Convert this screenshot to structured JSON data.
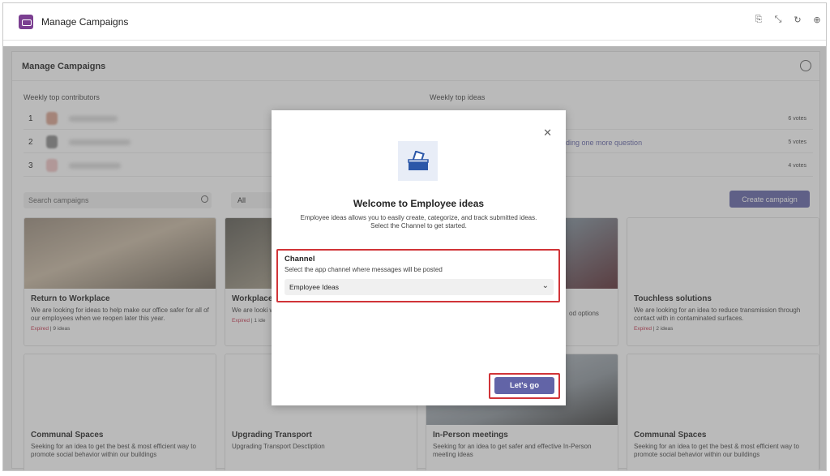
{
  "app": {
    "title": "Manage Campaigns",
    "actions": [
      "chat-icon",
      "minimize-icon",
      "refresh-icon",
      "globe-icon"
    ]
  },
  "page": {
    "heading": "Manage Campaigns",
    "contributors_label": "Weekly top contributors",
    "ideas_label": "Weekly top ideas",
    "contributors": [
      {
        "rank": "1"
      },
      {
        "rank": "2"
      },
      {
        "rank": "3"
      }
    ],
    "ideas": [
      {
        "votes": "6 votes",
        "text": ""
      },
      {
        "votes": "5 votes",
        "text": "dding one more question"
      },
      {
        "votes": "4 votes",
        "text": ""
      }
    ],
    "search_placeholder": "Search campaigns",
    "filter_value": "All",
    "create_label": "Create campaign"
  },
  "cards": [
    {
      "title": "Return to Workplace",
      "desc": "We are looking for ideas to help make our office safer for all of our employees when we reopen later this year.",
      "status": "Expired",
      "ideas": "9 ideas"
    },
    {
      "title": "Workplace",
      "desc": "We are looki workplace",
      "status": "Expired",
      "ideas": "1 ide"
    },
    {
      "title": "",
      "desc": "od options",
      "status": "",
      "ideas": ""
    },
    {
      "title": "Touchless solutions",
      "desc": "We are looking for an idea to reduce transmission through contact with in contaminated surfaces.",
      "status": "Expired",
      "ideas": "2 ideas"
    },
    {
      "title": "Communal Spaces",
      "desc": "Seeking for an idea to get the best & most efficient way to promote social behavior within our buildings"
    },
    {
      "title": "Upgrading Transport",
      "desc": "Upgrading Transport  Desctiption"
    },
    {
      "title": "In-Person meetings",
      "desc": "Seeking for an idea to get safer and effective In-Person meeting ideas"
    },
    {
      "title": "Communal Spaces",
      "desc": "Seeking for an idea to get the best & most efficient way to promote social behavior within our buildings"
    }
  ],
  "dialog": {
    "close": "✕",
    "title": "Welcome to Employee ideas",
    "description": "Employee ideas allows you to easily create, categorize, and track submitted ideas. Select the Channel to get started.",
    "channel_label": "Channel",
    "channel_help": "Select the app channel where messages will be posted",
    "channel_value": "Employee Ideas",
    "go_label": "Let's go"
  },
  "colors": {
    "accent": "#6264a7",
    "highlight": "#d13438",
    "expired": "#c4314b"
  }
}
